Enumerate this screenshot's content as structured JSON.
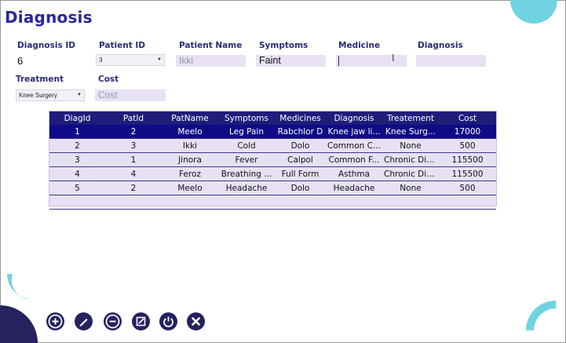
{
  "window": {
    "title": "Diagnosis"
  },
  "form": {
    "diagnosis_id": {
      "label": "Diagnosis ID",
      "value": "6"
    },
    "patient_id": {
      "label": "Patient ID",
      "value": "3"
    },
    "patient_name": {
      "label": "Patient Name",
      "placeholder": "Ikki"
    },
    "symptoms": {
      "label": "Symptoms",
      "value": "Faint"
    },
    "medicine": {
      "label": "Medicine",
      "value": ""
    },
    "diagnosis": {
      "label": "Diagnosis",
      "value": ""
    },
    "treatment": {
      "label": "Treatment",
      "value": "Knee Surgery"
    },
    "cost": {
      "label": "Cost",
      "placeholder": "Cost"
    }
  },
  "table": {
    "columns": [
      "DiagId",
      "PatId",
      "PatName",
      "Symptoms",
      "Medicines",
      "Diagnosis",
      "Treatement",
      "Cost"
    ],
    "rows": [
      [
        "1",
        "2",
        "Meelo",
        "Leg Pain",
        "Rabchlor D",
        "Knee jaw li...",
        "Knee Surg...",
        "17000"
      ],
      [
        "2",
        "3",
        "Ikki",
        "Cold",
        "Dolo",
        "Common C...",
        "None",
        "500"
      ],
      [
        "3",
        "1",
        "Jinora",
        "Fever",
        "Calpol",
        "Common F...",
        "Chronic Dis...",
        "115500"
      ],
      [
        "4",
        "4",
        "Feroz",
        "Breathing ...",
        "Full Form",
        "Asthma",
        "Chronic Dis...",
        "115500"
      ],
      [
        "5",
        "2",
        "Meelo",
        "Headache",
        "Dolo",
        "Headache",
        "None",
        "500"
      ]
    ],
    "selected_row": 0
  },
  "toolbar": {
    "icons": [
      "add-icon",
      "edit-icon",
      "remove-icon",
      "update-icon",
      "power-icon",
      "close-icon"
    ]
  },
  "colors": {
    "accent": "#2b2699",
    "header_bg": "#1f1c7a",
    "selected_row": "#0f0b86",
    "field_bg": "#e8e1f5",
    "decor": "#6fd3e2",
    "toolbar_button": "#26215f"
  }
}
